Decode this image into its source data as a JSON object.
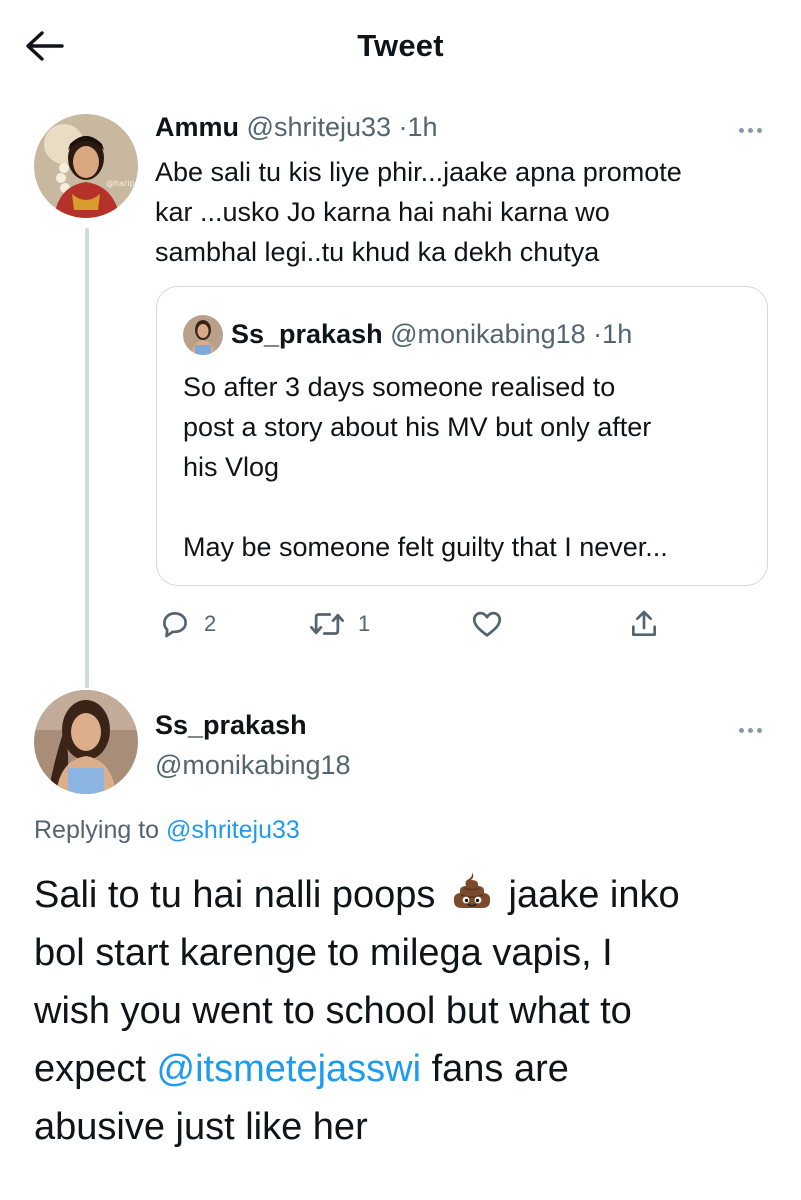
{
  "header": {
    "title": "Tweet",
    "back_icon": "arrow-left-icon"
  },
  "reply_tweet": {
    "author_name": "Ammu",
    "author_handle": "@shriteju33",
    "separator": "·",
    "time": "1h",
    "avatar_watermark": "@harip",
    "text_lines": [
      "Abe sali tu kis liye phir...jaake apna promote",
      "kar ...usko Jo karna hai nahi karna wo",
      "sambhal legi..tu khud ka dekh chutya"
    ],
    "quoted_tweet": {
      "author_name": "Ss_prakash",
      "author_handle": "@monikabing18",
      "separator": "·",
      "time": "1h",
      "text_lines": [
        "So after 3 days someone realised to",
        "post a story about his MV but only after",
        "his Vlog",
        "",
        "May be someone felt guilty that I never..."
      ]
    },
    "actions": {
      "reply_count": "2",
      "retweet_count": "1",
      "icons": [
        "reply-icon",
        "retweet-icon",
        "like-icon",
        "share-icon"
      ]
    }
  },
  "main_tweet": {
    "author_name": "Ss_prakash",
    "author_handle": "@monikabing18",
    "replying_label": "Replying to",
    "replying_handle": "@shriteju33",
    "line1_before": "Sali to tu hai nalli poops",
    "emoji": "pile-of-poo-emoji",
    "line1_after": "jaake inko",
    "line2": "bol start karenge to milega vapis, I",
    "line3": "wish you went to school but what to",
    "line4_before": "expect",
    "line4_mention": "@itsmetejasswi",
    "line4_after": "fans are",
    "line5": "abusive just like her"
  },
  "colors": {
    "text": "#0f1419",
    "secondary": "#536471",
    "link": "#1d9bf0",
    "border": "#cfd9de"
  }
}
